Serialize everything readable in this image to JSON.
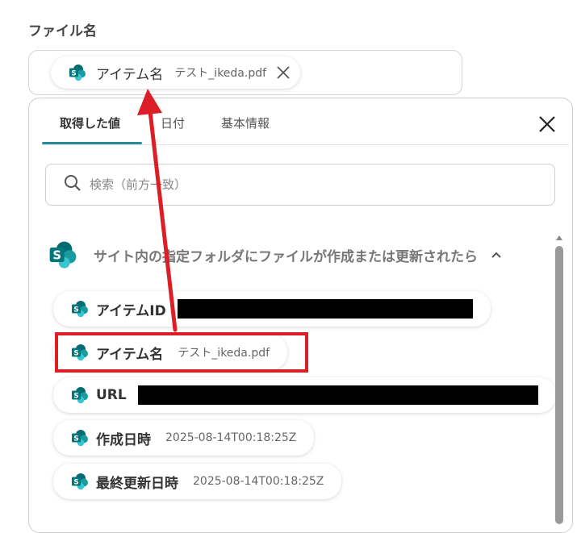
{
  "field": {
    "label": "ファイル名",
    "chip": {
      "label": "アイテム名",
      "value": "テスト_ikeda.pdf"
    }
  },
  "tabs": [
    {
      "label": "取得した値",
      "active": true
    },
    {
      "label": "日付",
      "active": false
    },
    {
      "label": "基本情報",
      "active": false
    }
  ],
  "search": {
    "placeholder": "検索（前方一致）"
  },
  "section": {
    "title": "サイト内の指定フォルダにファイルが作成または更新されたら"
  },
  "items": [
    {
      "label": "アイテムID",
      "value": ""
    },
    {
      "label": "アイテム名",
      "value": "テスト_ikeda.pdf"
    },
    {
      "label": "URL",
      "value": ""
    },
    {
      "label": "作成日時",
      "value": "2025-08-14T00:18:25Z"
    },
    {
      "label": "最終更新日時",
      "value": "2025-08-14T00:18:25Z"
    }
  ],
  "colors": {
    "accent": "#2a8b97",
    "highlight": "#dc1f26",
    "sharepoint_dark": "#036c70",
    "sharepoint_mid": "#1a9ba1",
    "sharepoint_light": "#37c6d0"
  },
  "icons": {
    "app": "sharepoint-icon",
    "remove": "close-icon",
    "search": "search-icon",
    "collapse": "chevron-up-icon"
  }
}
